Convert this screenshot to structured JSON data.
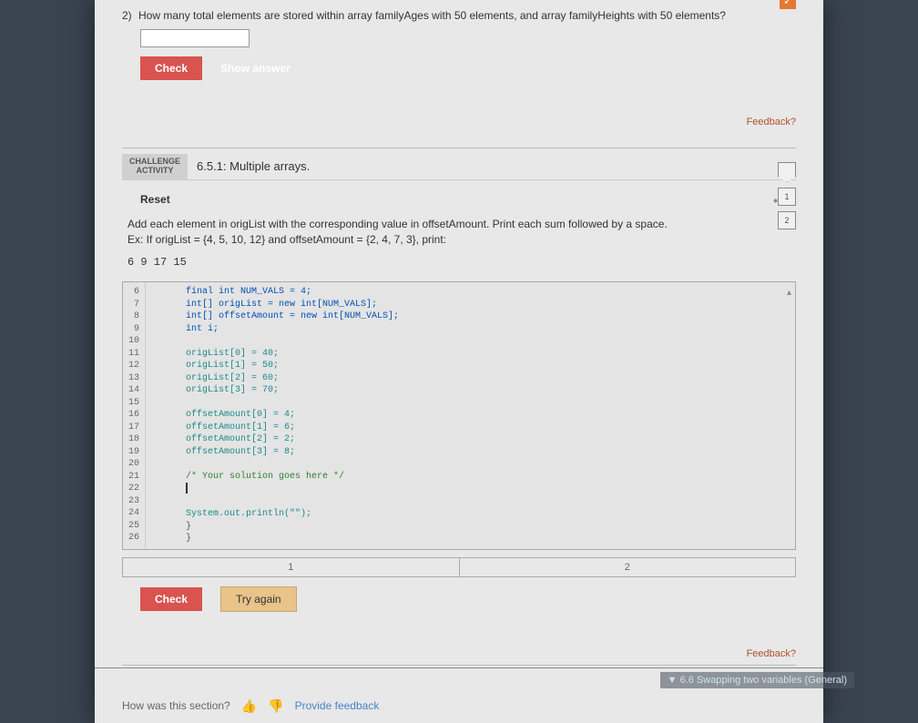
{
  "question2": {
    "number": "2)",
    "text": "How many total elements are stored within array familyAges with 50 elements, and array familyHeights with 50 elements?",
    "check_label": "Check",
    "show_answer_label": "Show answer",
    "feedback_label": "Feedback?"
  },
  "challenge": {
    "tag_line1": "CHALLENGE",
    "tag_line2": "ACTIVITY",
    "title": "6.5.1: Multiple arrays.",
    "reset_label": "Reset",
    "steps": [
      "1",
      "2"
    ],
    "instructions": "Add each element in origList with the corresponding value in offsetAmount. Print each sum followed by a space.",
    "example_prefix": "Ex: If origList = {4, 5, 10, 12} and offsetAmount = {2, 4, 7, 3}, print:",
    "example_output": "6 9 17 15",
    "code_lines": [
      {
        "n": "6",
        "t": "final int NUM_VALS = 4;",
        "cls": "kw-blue"
      },
      {
        "n": "7",
        "t": "int[] origList = new int[NUM_VALS];",
        "cls": "kw-blue"
      },
      {
        "n": "8",
        "t": "int[] offsetAmount = new int[NUM_VALS];",
        "cls": "kw-blue"
      },
      {
        "n": "9",
        "t": "int i;",
        "cls": "kw-blue"
      },
      {
        "n": "10",
        "t": "",
        "cls": ""
      },
      {
        "n": "11",
        "t": "origList[0] = 40;",
        "cls": "kw-teal"
      },
      {
        "n": "12",
        "t": "origList[1] = 50;",
        "cls": "kw-teal"
      },
      {
        "n": "13",
        "t": "origList[2] = 60;",
        "cls": "kw-teal"
      },
      {
        "n": "14",
        "t": "origList[3] = 70;",
        "cls": "kw-teal"
      },
      {
        "n": "15",
        "t": "",
        "cls": ""
      },
      {
        "n": "16",
        "t": "offsetAmount[0] = 4;",
        "cls": "kw-teal"
      },
      {
        "n": "17",
        "t": "offsetAmount[1] = 6;",
        "cls": "kw-teal"
      },
      {
        "n": "18",
        "t": "offsetAmount[2] = 2;",
        "cls": "kw-teal"
      },
      {
        "n": "19",
        "t": "offsetAmount[3] = 8;",
        "cls": "kw-teal"
      },
      {
        "n": "20",
        "t": "",
        "cls": ""
      },
      {
        "n": "21",
        "t": "/* Your solution goes here */",
        "cls": "kw-green"
      },
      {
        "n": "22",
        "t": "|",
        "cls": ""
      },
      {
        "n": "23",
        "t": "",
        "cls": ""
      },
      {
        "n": "24",
        "t": "System.out.println(\"\");",
        "cls": "kw-teal"
      },
      {
        "n": "25",
        "t": "}",
        "cls": ""
      },
      {
        "n": "26",
        "t": "}",
        "cls": ""
      }
    ],
    "test_cells": [
      "1",
      "2"
    ],
    "check_label": "Check",
    "try_label": "Try again",
    "feedback_label": "Feedback?"
  },
  "footer": {
    "prompt": "How was this section?",
    "provide_label": "Provide feedback",
    "next_label": "6.6 Swapping two variables (General)"
  }
}
